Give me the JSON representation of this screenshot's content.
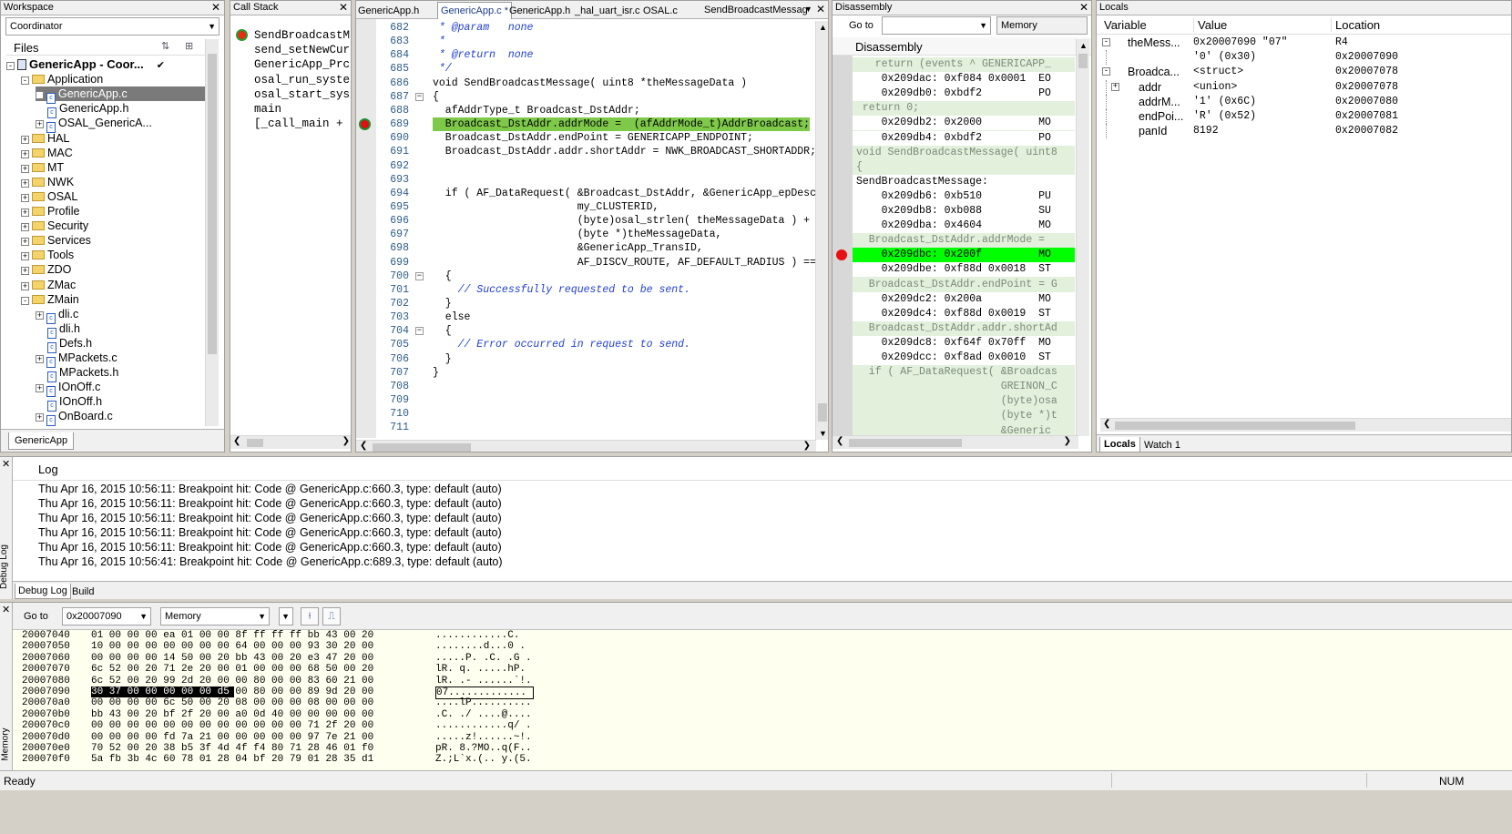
{
  "workspace": {
    "title": "Workspace",
    "config": "Coordinator",
    "files_header": "Files",
    "tab": "GenericApp",
    "tree": [
      {
        "label": "GenericApp - Coor...",
        "level": 0,
        "type": "project",
        "exp": "-"
      },
      {
        "label": "Application",
        "level": 1,
        "type": "folder",
        "exp": "-"
      },
      {
        "label": "GenericApp.c",
        "level": 2,
        "type": "file",
        "exp": "+",
        "selected": true
      },
      {
        "label": "GenericApp.h",
        "level": 2,
        "type": "file",
        "exp": ""
      },
      {
        "label": "OSAL_GenericA...",
        "level": 2,
        "type": "file",
        "exp": "+"
      },
      {
        "label": "HAL",
        "level": 1,
        "type": "folder",
        "exp": "+"
      },
      {
        "label": "MAC",
        "level": 1,
        "type": "folder",
        "exp": "+"
      },
      {
        "label": "MT",
        "level": 1,
        "type": "folder",
        "exp": "+"
      },
      {
        "label": "NWK",
        "level": 1,
        "type": "folder",
        "exp": "+"
      },
      {
        "label": "OSAL",
        "level": 1,
        "type": "folder",
        "exp": "+"
      },
      {
        "label": "Profile",
        "level": 1,
        "type": "folder",
        "exp": "+"
      },
      {
        "label": "Security",
        "level": 1,
        "type": "folder",
        "exp": "+"
      },
      {
        "label": "Services",
        "level": 1,
        "type": "folder",
        "exp": "+"
      },
      {
        "label": "Tools",
        "level": 1,
        "type": "folder",
        "exp": "+"
      },
      {
        "label": "ZDO",
        "level": 1,
        "type": "folder",
        "exp": "+"
      },
      {
        "label": "ZMac",
        "level": 1,
        "type": "folder",
        "exp": "+"
      },
      {
        "label": "ZMain",
        "level": 1,
        "type": "folder",
        "exp": "-"
      },
      {
        "label": "dli.c",
        "level": 2,
        "type": "file",
        "exp": "+"
      },
      {
        "label": "dli.h",
        "level": 2,
        "type": "file",
        "exp": ""
      },
      {
        "label": "Defs.h",
        "level": 2,
        "type": "file",
        "exp": ""
      },
      {
        "label": "MPackets.c",
        "level": 2,
        "type": "file",
        "exp": "+"
      },
      {
        "label": "MPackets.h",
        "level": 2,
        "type": "file",
        "exp": ""
      },
      {
        "label": "IOnOff.c",
        "level": 2,
        "type": "file",
        "exp": "+"
      },
      {
        "label": "IOnOff.h",
        "level": 2,
        "type": "file",
        "exp": ""
      },
      {
        "label": "OnBoard.c",
        "level": 2,
        "type": "file",
        "exp": "+"
      }
    ]
  },
  "callstack": {
    "title": "Call Stack",
    "items": [
      "SendBroadcastM",
      "send_setNewCur",
      "GenericApp_Prc",
      "osal_run_syste",
      "osal_start_sys",
      "main",
      "[_call_main +"
    ]
  },
  "editor": {
    "tabs": [
      "GenericApp.h",
      "GenericApp.c *",
      "GenericApp.h",
      "_hal_uart_isr.c",
      "OSAL.c"
    ],
    "function_box": "SendBroadcastMessag",
    "lines": [
      {
        "n": "682",
        "t": " * @param   none",
        "c": "cm"
      },
      {
        "n": "683",
        "t": " *",
        "c": "cm"
      },
      {
        "n": "684",
        "t": " * @return  none",
        "c": "cm"
      },
      {
        "n": "685",
        "t": " */",
        "c": "cm"
      },
      {
        "n": "686",
        "t": "void SendBroadcastMessage( uint8 *theMessageData )",
        "c": ""
      },
      {
        "n": "687",
        "t": "{",
        "c": ""
      },
      {
        "n": "688",
        "t": "  afAddrType_t Broadcast_DstAddr;",
        "c": ""
      },
      {
        "n": "689",
        "t": "  Broadcast_DstAddr.addrMode =  (afAddrMode_t)AddrBroadcast;",
        "c": "hl"
      },
      {
        "n": "690",
        "t": "  Broadcast_DstAddr.endPoint = GENERICAPP_ENDPOINT;",
        "c": ""
      },
      {
        "n": "691",
        "t": "  Broadcast_DstAddr.addr.shortAddr = NWK_BROADCAST_SHORTADDR;",
        "c": ""
      },
      {
        "n": "692",
        "t": "",
        "c": ""
      },
      {
        "n": "693",
        "t": "",
        "c": ""
      },
      {
        "n": "694",
        "t": "  if ( AF_DataRequest( &Broadcast_DstAddr, &GenericApp_epDesc,",
        "c": ""
      },
      {
        "n": "695",
        "t": "                       my_CLUSTERID,",
        "c": ""
      },
      {
        "n": "696",
        "t": "                       (byte)osal_strlen( theMessageData ) + 1,",
        "c": ""
      },
      {
        "n": "697",
        "t": "                       (byte *)theMessageData,",
        "c": ""
      },
      {
        "n": "698",
        "t": "                       &GenericApp_TransID,",
        "c": ""
      },
      {
        "n": "699",
        "t": "                       AF_DISCV_ROUTE, AF_DEFAULT_RADIUS ) == afSt",
        "c": ""
      },
      {
        "n": "700",
        "t": "  {",
        "c": ""
      },
      {
        "n": "701",
        "t": "    // Successfully requested to be sent.",
        "c": "cm"
      },
      {
        "n": "702",
        "t": "  }",
        "c": ""
      },
      {
        "n": "703",
        "t": "  else",
        "c": "kw"
      },
      {
        "n": "704",
        "t": "  {",
        "c": ""
      },
      {
        "n": "705",
        "t": "    // Error occurred in request to send.",
        "c": "cm"
      },
      {
        "n": "706",
        "t": "  }",
        "c": ""
      },
      {
        "n": "707",
        "t": "}",
        "c": ""
      },
      {
        "n": "708",
        "t": "",
        "c": ""
      },
      {
        "n": "709",
        "t": "",
        "c": ""
      },
      {
        "n": "710",
        "t": "",
        "c": ""
      },
      {
        "n": "711",
        "t": "",
        "c": ""
      }
    ]
  },
  "disassembly": {
    "title": "Disassembly",
    "goto_label": "Go to",
    "mode": "Memory",
    "header": "Disassembly",
    "lines": [
      {
        "t": "   return (events ^ GENERICAPP_",
        "c": "g"
      },
      {
        "t": "    0x209dac: 0xf084 0x0001  EO",
        "c": ""
      },
      {
        "t": "    0x209db0: 0xbdf2         PO",
        "c": ""
      },
      {
        "t": " return 0;",
        "c": "g"
      },
      {
        "t": "    0x209db2: 0x2000         MO",
        "c": ""
      },
      {
        "t": "    0x209db4: 0xbdf2         PO",
        "c": ""
      },
      {
        "t": "void SendBroadcastMessage( uint8",
        "c": "g"
      },
      {
        "t": "{",
        "c": "g"
      },
      {
        "t": "SendBroadcastMessage:",
        "c": "b"
      },
      {
        "t": "    0x209db6: 0xb510         PU",
        "c": ""
      },
      {
        "t": "    0x209db8: 0xb088         SU",
        "c": ""
      },
      {
        "t": "    0x209dba: 0x4604         MO",
        "c": ""
      },
      {
        "t": "  Broadcast_DstAddr.addrMode =",
        "c": "g"
      },
      {
        "t": "    0x209dbc: 0x200f         MO",
        "c": "hl"
      },
      {
        "t": "    0x209dbe: 0xf88d 0x0018  ST",
        "c": ""
      },
      {
        "t": "  Broadcast_DstAddr.endPoint = G",
        "c": "g"
      },
      {
        "t": "    0x209dc2: 0x200a         MO",
        "c": ""
      },
      {
        "t": "    0x209dc4: 0xf88d 0x0019  ST",
        "c": ""
      },
      {
        "t": "  Broadcast_DstAddr.addr.shortAd",
        "c": "g"
      },
      {
        "t": "    0x209dc8: 0xf64f 0x70ff  MO",
        "c": ""
      },
      {
        "t": "    0x209dcc: 0xf8ad 0x0010  ST",
        "c": ""
      },
      {
        "t": "  if ( AF_DataRequest( &Broadcas",
        "c": "g"
      },
      {
        "t": "                       GREINON_C",
        "c": "g"
      },
      {
        "t": "                       (byte)osa",
        "c": "g"
      },
      {
        "t": "                       (byte *)t",
        "c": "g"
      },
      {
        "t": "                       &Generic",
        "c": "g"
      }
    ]
  },
  "locals": {
    "title": "Locals",
    "headers": [
      "Variable",
      "Value",
      "Location"
    ],
    "rows": [
      {
        "var": "theMess...",
        "val": "0x20007090 \"07\"",
        "loc": "R4",
        "indent": 0,
        "exp": "-"
      },
      {
        "var": "",
        "val": "'0' (0x30)",
        "loc": "0x20007090",
        "indent": 1,
        "exp": ""
      },
      {
        "var": "Broadca...",
        "val": "<struct>",
        "loc": "0x20007078",
        "indent": 0,
        "exp": "-"
      },
      {
        "var": "addr",
        "val": "<union>",
        "loc": "0x20007078",
        "indent": 1,
        "exp": "+"
      },
      {
        "var": "addrM...",
        "val": "'1' (0x6C)",
        "loc": "0x20007080",
        "indent": 1,
        "exp": ""
      },
      {
        "var": "endPoi...",
        "val": "'R' (0x52)",
        "loc": "0x20007081",
        "indent": 1,
        "exp": ""
      },
      {
        "var": "panId",
        "val": "8192",
        "loc": "0x20007082",
        "indent": 1,
        "exp": ""
      }
    ],
    "tabs": [
      "Locals",
      "Watch 1"
    ]
  },
  "log": {
    "header": "Log",
    "side_label": "Debug Log",
    "entries": [
      "Thu Apr 16, 2015 10:56:11: Breakpoint hit: Code @ GenericApp.c:660.3, type: default (auto)",
      "Thu Apr 16, 2015 10:56:11: Breakpoint hit: Code @ GenericApp.c:660.3, type: default (auto)",
      "Thu Apr 16, 2015 10:56:11: Breakpoint hit: Code @ GenericApp.c:660.3, type: default (auto)",
      "Thu Apr 16, 2015 10:56:11: Breakpoint hit: Code @ GenericApp.c:660.3, type: default (auto)",
      "Thu Apr 16, 2015 10:56:11: Breakpoint hit: Code @ GenericApp.c:660.3, type: default (auto)",
      "Thu Apr 16, 2015 10:56:41: Breakpoint hit: Code @ GenericApp.c:689.3, type: default (auto)"
    ],
    "tabs": [
      "Debug Log",
      "Build"
    ]
  },
  "memory": {
    "side_label": "Memory",
    "goto_label": "Go to",
    "address": "0x20007090",
    "mode": "Memory",
    "rows": [
      {
        "a": "20007040",
        "h": "01 00 00 00 ea 01 00 00 8f ff ff ff bb 43 00 20",
        "s": "............C. "
      },
      {
        "a": "20007050",
        "h": "10 00 00 00 00 00 00 00 64 00 00 00 93 30 20 00",
        "s": "........d...0 . "
      },
      {
        "a": "20007060",
        "h": "00 00 00 00 14 50 00 20 bb 43 00 20 e3 47 20 00",
        "s": ".....P. .C. .G . "
      },
      {
        "a": "20007070",
        "h": "6c 52 00 20 71 2e 20 00 01 00 00 00 68 50 00 20",
        "s": "lR. q. .....hP. "
      },
      {
        "a": "20007080",
        "h": "6c 52 00 20 99 2d 20 00 00 80 00 00 83 60 21 00",
        "s": "lR. .- ......`!. "
      },
      {
        "a": "20007090",
        "h": "30 37 00 00 00 00 00 d5 00 80 00 00 89 9d 20 00",
        "s": "07............. "
      },
      {
        "a": "200070a0",
        "h": "00 00 00 00 6c 50 00 20 08 00 00 00 08 00 00 00",
        "s": "....lP.......... "
      },
      {
        "a": "200070b0",
        "h": "bb 43 00 20 bf 2f 20 00 a0 0d 40 00 00 00 00 00",
        "s": ".C. ./ ....@.... "
      },
      {
        "a": "200070c0",
        "h": "00 00 00 00 00 00 00 00 00 00 00 00 71 2f 20 00",
        "s": "............q/ . "
      },
      {
        "a": "200070d0",
        "h": "00 00 00 00 fd 7a 21 00 00 00 00 00 97 7e 21 00",
        "s": ".....z!......~!. "
      },
      {
        "a": "200070e0",
        "h": "70 52 00 20 38 b5 3f 4d 4f f4 80 71 28 46 01 f0",
        "s": "pR. 8.?MO..q(F.. "
      },
      {
        "a": "200070f0",
        "h": "5a fb 3b 4c 60 78 01 28 04 bf 20 79 01 28 35 d1",
        "s": "Z.;L`x.(.. y.(5. "
      }
    ]
  },
  "status": {
    "text": "Ready",
    "num": "NUM"
  },
  "colors": {
    "highlight": "#7fc94a",
    "disasm_highlight": "#00ff00",
    "breakpoint": "#e81010",
    "memory_bg": "#ffffef"
  }
}
